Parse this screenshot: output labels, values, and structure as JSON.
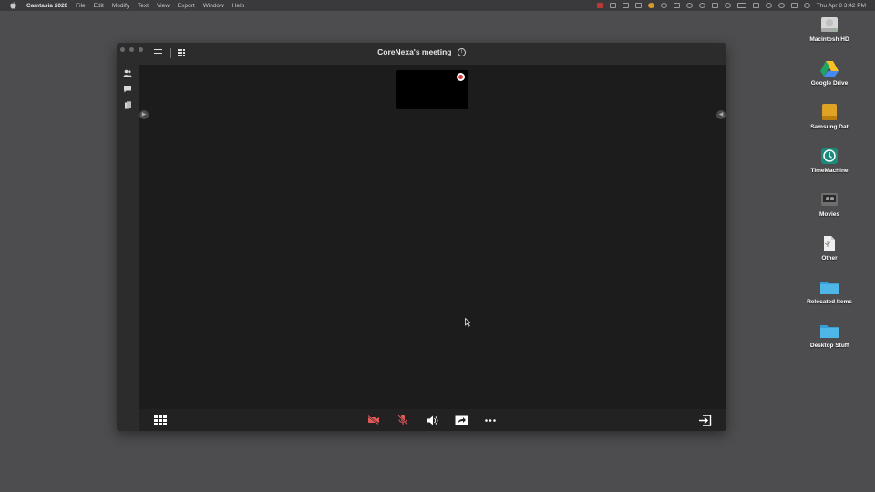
{
  "menubar": {
    "app_name": "Camtasia 2020",
    "menus": [
      "File",
      "Edit",
      "Modify",
      "Text",
      "View",
      "Export",
      "Window",
      "Help"
    ],
    "clock": "Thu Apr 8  3:42 PM"
  },
  "window": {
    "title": "CoreNexa's meeting",
    "sidebar_icons": [
      "participants-icon",
      "chat-icon",
      "whiteboard-icon"
    ],
    "toolbar": [
      "dialpad-icon",
      "camera-off-icon",
      "mic-off-icon",
      "speaker-icon",
      "share-screen-icon",
      "more-icon",
      "leave-icon"
    ]
  },
  "colors": {
    "desktop": "#4d4d4f",
    "stage": "#1c1c1c",
    "muted_red": "#e05a5a",
    "folder_blue": "#4fb6e8"
  },
  "desktop": {
    "items": [
      {
        "label": "Macintosh HD",
        "icon": "hard-drive-icon"
      },
      {
        "label": "Google Drive",
        "icon": "google-drive-icon"
      },
      {
        "label": "Samsung Dat",
        "icon": "external-drive-icon"
      },
      {
        "label": "TimeMachine",
        "icon": "time-machine-icon"
      },
      {
        "label": "Movies",
        "icon": "movies-drive-icon"
      },
      {
        "label": "Other",
        "icon": "usb-drive-icon"
      },
      {
        "label": "Relocated Items",
        "icon": "folder-icon"
      },
      {
        "label": "Desktop Stuff",
        "icon": "folder-icon"
      }
    ]
  }
}
